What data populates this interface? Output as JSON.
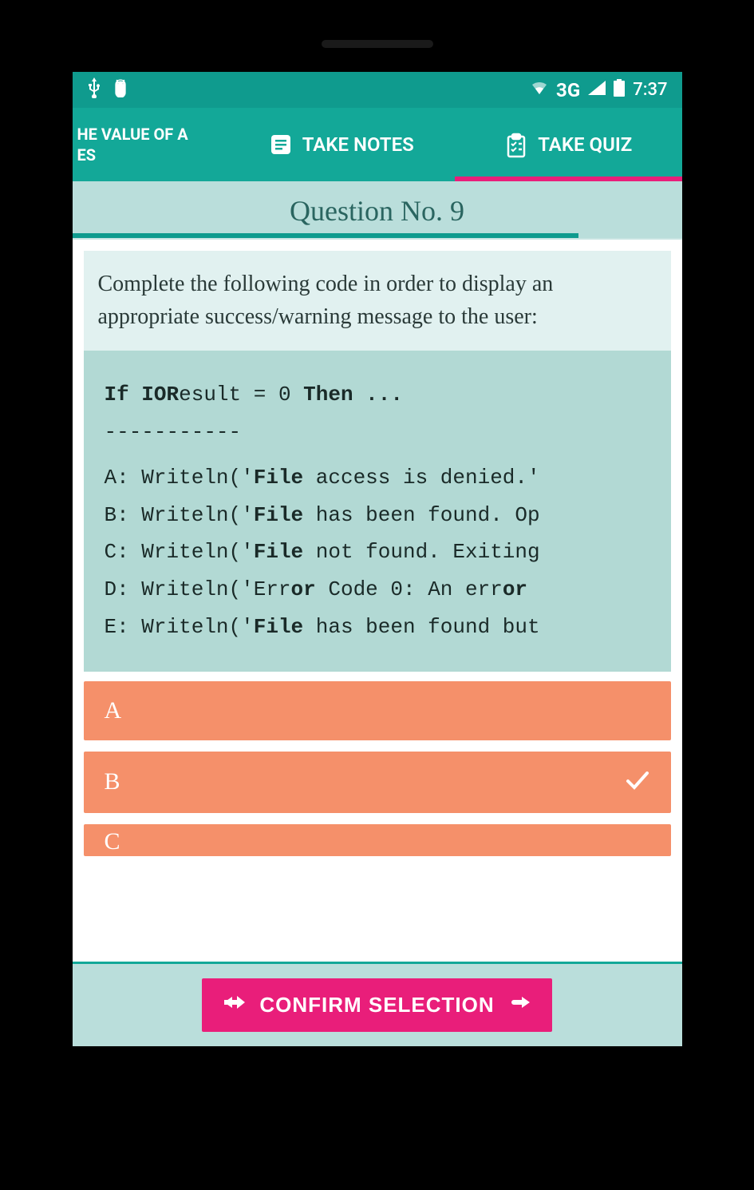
{
  "statusBar": {
    "time": "7:37",
    "network": "3G"
  },
  "header": {
    "titleLine1": "HE VALUE OF A",
    "titleLine2": "ES",
    "tabNotes": "TAKE NOTES",
    "tabQuiz": "TAKE QUIZ"
  },
  "question": {
    "title": "Question No. 9",
    "prompt": "Complete the following code in order to display an appropriate success/warning message to the user:"
  },
  "code": {
    "line1a": "If IOR",
    "line1b": "esult = 0 ",
    "line1c": "Then ...",
    "divider": "-----------",
    "a_pre": "A: Writeln('",
    "a_b": "File",
    "a_post": " access is denied.'",
    "b_pre": "B: Writeln('",
    "b_b": "File",
    "b_post": " has been found. Op",
    "c_pre": "C: Writeln('",
    "c_b": "File",
    "c_post": " not found. Exiting",
    "d_pre": "D: Writeln('Err",
    "d_b1": "or",
    "d_mid": " Code 0: An err",
    "d_b2": "or",
    "e_pre": "E: Writeln('",
    "e_b": "File",
    "e_post": " has been found but"
  },
  "answers": {
    "a": "A",
    "b": "B",
    "c": "C",
    "selected": "B"
  },
  "footer": {
    "confirm": "CONFIRM SELECTION"
  }
}
